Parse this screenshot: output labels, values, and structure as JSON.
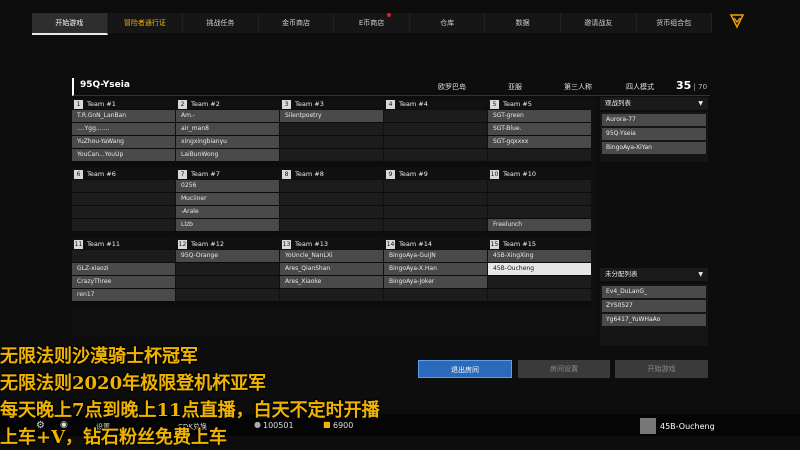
{
  "nav": {
    "tabs": [
      {
        "label": "开始游戏"
      },
      {
        "label": "冒险者通行证"
      },
      {
        "label": "挑战任务"
      },
      {
        "label": "金币商店"
      },
      {
        "label": "E币商店"
      },
      {
        "label": "仓库"
      },
      {
        "label": "数据"
      },
      {
        "label": "邀请战友"
      },
      {
        "label": "货币组合包"
      }
    ],
    "corner_icon": "chevron-down-icon"
  },
  "room": {
    "name": "95Q-Yseia",
    "map": "欧罗巴岛",
    "server": "亚服",
    "perspective": "第三人称",
    "mode": "四人模式",
    "count": "35",
    "max": "70"
  },
  "teams": [
    {
      "num": "1",
      "label": "Team #1",
      "players": [
        "T.R.GnN_LanBan",
        "....Ygg.......",
        "YuZhou-YaWang",
        "YouCan...YouUp"
      ]
    },
    {
      "num": "2",
      "label": "Team #2",
      "players": [
        "Am.-",
        "air_man8",
        "xingxingbianyu",
        "LaiBunWong"
      ]
    },
    {
      "num": "3",
      "label": "Team #3",
      "players": [
        "Silentpoetry",
        "",
        "",
        ""
      ]
    },
    {
      "num": "4",
      "label": "Team #4",
      "players": [
        "",
        "",
        "",
        ""
      ]
    },
    {
      "num": "5",
      "label": "Team #5",
      "players": [
        "SGT-green",
        "SGT-Blue.",
        "SGT-gqxxxx",
        ""
      ]
    },
    {
      "num": "6",
      "label": "Team #6",
      "players": [
        "",
        "",
        "",
        ""
      ]
    },
    {
      "num": "7",
      "label": "Team #7",
      "players": [
        "0256",
        "Muciiner",
        "-Arale",
        "Llzb"
      ]
    },
    {
      "num": "8",
      "label": "Team #8",
      "players": [
        "",
        "",
        "",
        ""
      ]
    },
    {
      "num": "9",
      "label": "Team #9",
      "players": [
        "",
        "",
        "",
        ""
      ]
    },
    {
      "num": "10",
      "label": "Team #10",
      "players": [
        "",
        "",
        "",
        "Freelunch"
      ]
    },
    {
      "num": "11",
      "label": "Team #11",
      "players": [
        "",
        "GLZ-xiaozi",
        "CrazyThree",
        "ren17"
      ]
    },
    {
      "num": "12",
      "label": "Team #12",
      "players": [
        "95Q-Orange",
        "",
        "",
        ""
      ]
    },
    {
      "num": "13",
      "label": "Team #13",
      "players": [
        "YoUncle_NanLXi",
        "Ares_QianShan",
        "Ares_Xiaoke",
        ""
      ]
    },
    {
      "num": "14",
      "label": "Team #14",
      "players": [
        "BingoAya-GuiJN",
        "BingoAya-X.Han",
        "BingoAya-Joker",
        ""
      ]
    },
    {
      "num": "15",
      "label": "Team #15",
      "players": [
        "45B-XingXing",
        "45B-Oucheng",
        "",
        ""
      ]
    }
  ],
  "me": "45B-Oucheng",
  "spectators": {
    "title": "观战列表",
    "items": [
      "Aurora-77",
      "95Q-Yseia",
      "BingoAya-XiYan"
    ]
  },
  "unassigned": {
    "title": "未分配列表",
    "items": [
      "Ev4_DuLanG_",
      "ZYS0527",
      "Yg6417_YuWHaAo"
    ]
  },
  "buttons": {
    "exit": "退出房间",
    "room_settings": "房间设置",
    "start": "开始游戏"
  },
  "overlay_lines": [
    "无限法则沙漠骑士杯冠军",
    "无限法则2020年极限登机杯亚军",
    "每天晚上7点到晚上11点直播，白天不定时开播",
    "上车+V，钻石粉丝免费上车"
  ],
  "statusbar": {
    "settings": "设置",
    "cdk": "CDK兑换",
    "coins": "100501",
    "ecoins": "6900",
    "username": "45B-Oucheng"
  }
}
